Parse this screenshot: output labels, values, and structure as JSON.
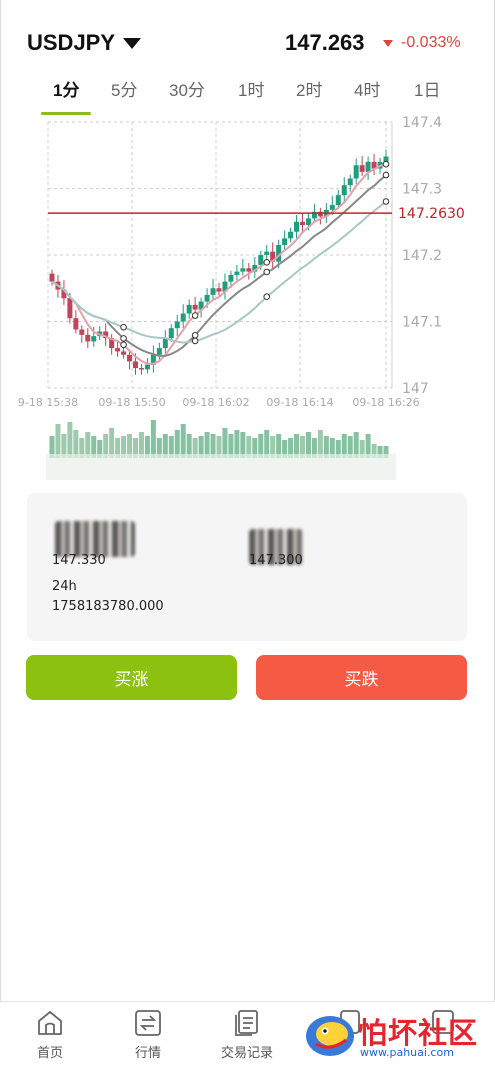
{
  "header": {
    "symbol": "USDJPY",
    "price": "147.263",
    "change": "-0.033%"
  },
  "tabs": [
    {
      "label": "1分",
      "active": true
    },
    {
      "label": "5分",
      "active": false
    },
    {
      "label": "30分",
      "active": false
    },
    {
      "label": "1时",
      "active": false
    },
    {
      "label": "2时",
      "active": false
    },
    {
      "label": "4时",
      "active": false
    },
    {
      "label": "1日",
      "active": false
    }
  ],
  "chart_data": {
    "type": "candlestick",
    "y_ticks": [
      "147.4",
      "147.3",
      "147.2",
      "147.1",
      "147"
    ],
    "ylim": [
      147.0,
      147.4
    ],
    "x_ticks": [
      "9-18 15:38",
      "09-18 15:50",
      "09-18 16:02",
      "09-18 16:14",
      "09-18 16:26"
    ],
    "last_price_label": "147.2630",
    "last_price": 147.263,
    "colors": {
      "up": "#1f9e7c",
      "down": "#c2445b",
      "ma_fast": "#e5a0a8",
      "ma_mid": "#888888",
      "ma_slow": "#a9c7c5",
      "last_line": "#c0242b"
    },
    "closes": [
      147.16,
      147.148,
      147.135,
      147.105,
      147.088,
      147.08,
      147.07,
      147.078,
      147.085,
      147.075,
      147.06,
      147.055,
      147.05,
      147.04,
      147.03,
      147.028,
      147.035,
      147.05,
      147.06,
      147.075,
      147.09,
      147.1,
      147.112,
      147.125,
      147.118,
      147.13,
      147.14,
      147.15,
      147.145,
      147.16,
      147.17,
      147.175,
      147.18,
      147.175,
      147.185,
      147.2,
      147.205,
      147.19,
      147.215,
      147.225,
      147.235,
      147.25,
      147.245,
      147.255,
      147.265,
      147.258,
      147.268,
      147.275,
      147.29,
      147.305,
      147.315,
      147.335,
      147.325,
      147.34,
      147.33,
      147.34,
      147.348
    ],
    "volumes": [
      0.55,
      0.85,
      0.6,
      0.9,
      0.7,
      0.5,
      0.65,
      0.55,
      0.45,
      0.6,
      0.75,
      0.5,
      0.55,
      0.6,
      0.5,
      0.65,
      0.55,
      0.95,
      0.5,
      0.6,
      0.55,
      0.7,
      0.85,
      0.6,
      0.5,
      0.55,
      0.65,
      0.6,
      0.55,
      0.75,
      0.6,
      0.7,
      0.65,
      0.55,
      0.5,
      0.6,
      0.7,
      0.55,
      0.6,
      0.45,
      0.5,
      0.6,
      0.55,
      0.65,
      0.5,
      0.7,
      0.55,
      0.5,
      0.45,
      0.6,
      0.55,
      0.65,
      0.45,
      0.6,
      0.35,
      0.3,
      0.3
    ]
  },
  "info": {
    "left_value": "147.330",
    "right_value": "147.300",
    "volume_label": "24h",
    "volume_value": "1758183780.000"
  },
  "actions": {
    "buy_label": "买涨",
    "sell_label": "买跌"
  },
  "bottom_nav": [
    {
      "label": "首页",
      "icon": "home-icon"
    },
    {
      "label": "行情",
      "icon": "exchange-icon"
    },
    {
      "label": "交易记录",
      "icon": "document-icon"
    }
  ],
  "watermark": {
    "title": "怕坏社区",
    "url": "www.pahuai.com"
  }
}
